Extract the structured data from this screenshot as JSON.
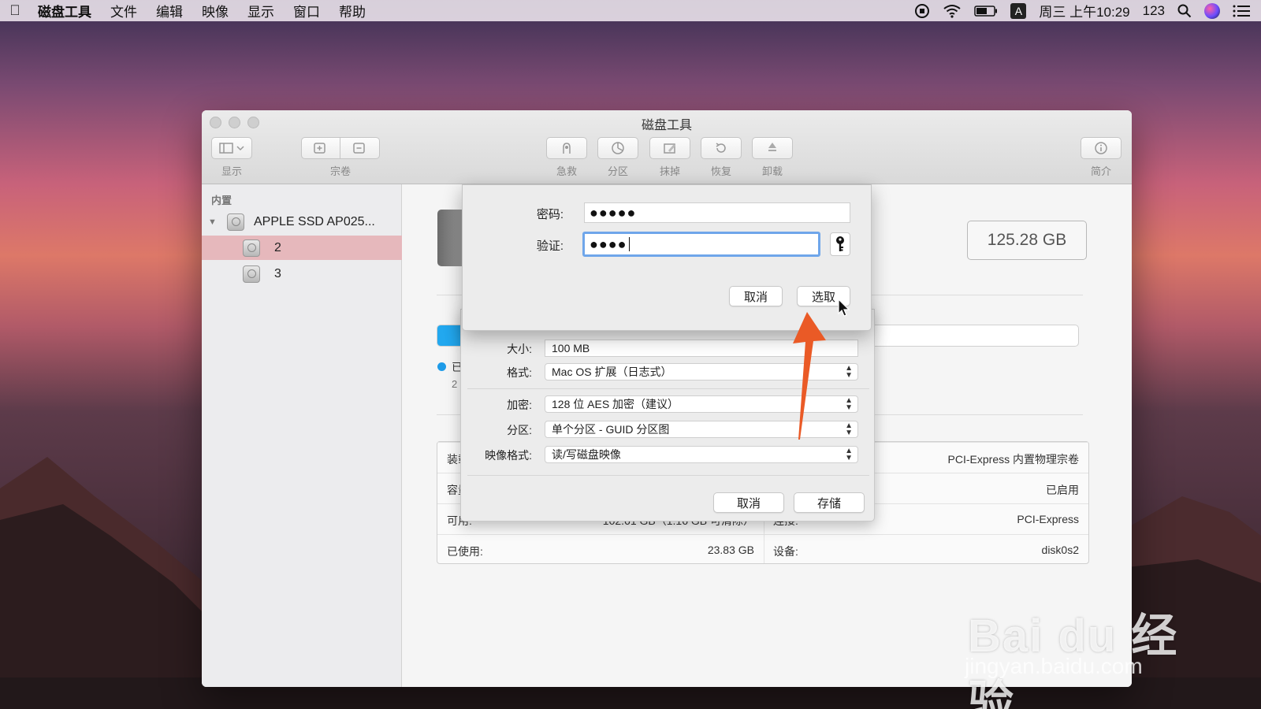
{
  "menubar": {
    "apple": "",
    "items": [
      "磁盘工具",
      "文件",
      "编辑",
      "映像",
      "显示",
      "窗口",
      "帮助"
    ],
    "input_method": "A",
    "datetime": "周三 上午10:29",
    "user": "123"
  },
  "window": {
    "title": "磁盘工具",
    "toolbar": {
      "view_label": "显示",
      "volume_label": "宗卷",
      "first_aid_label": "急救",
      "partition_label": "分区",
      "erase_label": "抹掉",
      "restore_label": "恢复",
      "unmount_label": "卸载",
      "info_label": "简介"
    },
    "sidebar": {
      "section": "内置",
      "disk": "APPLE SSD AP025...",
      "volumes": [
        "2",
        "3"
      ]
    },
    "main": {
      "capacity": "125.28 GB",
      "legend_text": "已",
      "legend_sub": "2",
      "table": {
        "row1_left_key": "装载",
        "row1_right_value": "PCI-Express 内置物理宗卷",
        "row2_left_key": "容量",
        "row2_right_value": "已启用",
        "row3_left_key": "可用:",
        "row3_left_value": "102.61 GB（1.16 GB 可清除）",
        "row3_right_key": "连接:",
        "row3_right_value": "PCI-Express",
        "row4_left_key": "已使用:",
        "row4_left_value": "23.83 GB",
        "row4_right_key": "设备:",
        "row4_right_value": "disk0s2"
      }
    },
    "new_image_sheet": {
      "size_label": "大小:",
      "size_value": "100 MB",
      "format_label": "格式:",
      "format_value": "Mac OS 扩展（日志式）",
      "encryption_label": "加密:",
      "encryption_value": "128 位 AES 加密（建议）",
      "partition_label": "分区:",
      "partition_value": "单个分区 - GUID 分区图",
      "image_format_label": "映像格式:",
      "image_format_value": "读/写磁盘映像",
      "cancel_label": "取消",
      "save_label": "存储"
    },
    "password_dialog": {
      "password_label": "密码:",
      "password_value": "●●●●●",
      "verify_label": "验证:",
      "verify_value": "●●●●",
      "cancel_label": "取消",
      "choose_label": "选取"
    }
  },
  "watermark": {
    "main": "Bai  du 经验",
    "sub": "jingyan.baidu.com"
  },
  "colors": {
    "accent_blue": "#22a8ef",
    "selection_pink": "#e6b8bc",
    "arrow_orange": "#ea5a26",
    "focus_ring": "#6fa6ea"
  }
}
